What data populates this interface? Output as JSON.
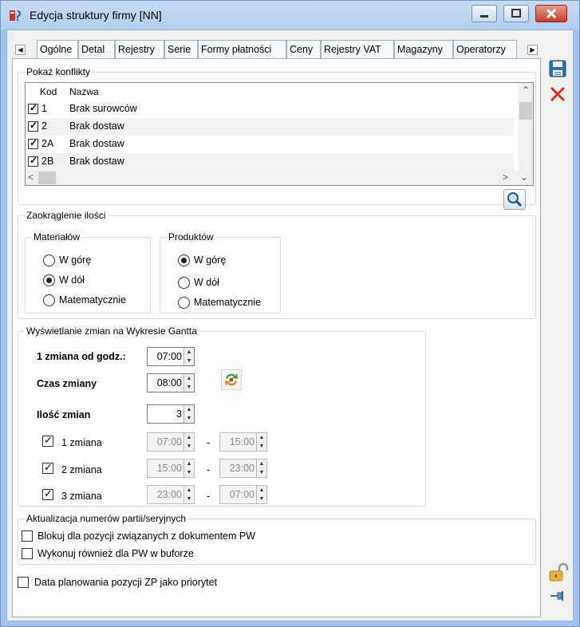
{
  "window": {
    "title": "Edycja struktury firmy [NN]"
  },
  "tabs": [
    "Ogólne",
    "Detal",
    "Rejestry",
    "Serie",
    "Formy płatności",
    "Ceny",
    "Rejestry VAT",
    "Magazyny",
    "Operatorzy"
  ],
  "conflicts": {
    "title": "Pokaż konflikty",
    "columns": {
      "code": "Kod",
      "name": "Nazwa"
    },
    "rows": [
      {
        "code": "1",
        "name": "Brak surowców",
        "checked": true
      },
      {
        "code": "2",
        "name": "Brak dostaw",
        "checked": true
      },
      {
        "code": "2A",
        "name": "Brak dostaw",
        "checked": true
      },
      {
        "code": "2B",
        "name": "Brak dostaw",
        "checked": true
      }
    ]
  },
  "rounding": {
    "title": "Zaokrąglenie ilości",
    "materials": {
      "title": "Materiałów",
      "options": [
        "W górę",
        "W dół",
        "Matematycznie"
      ],
      "selected": "W dół"
    },
    "products": {
      "title": "Produktów",
      "options": [
        "W górę",
        "W dół",
        "Matematycznie"
      ],
      "selected": "W górę"
    }
  },
  "gantt": {
    "title": "Wyświetlanie zmian na Wykresie Gantta",
    "first_shift_label": "1 zmiana od godz.:",
    "first_shift_value": "07:00",
    "shift_length_label": "Czas zmiany",
    "shift_length_value": "08:00",
    "shift_count_label": "Ilość zmian",
    "shift_count_value": "3",
    "dash": "-",
    "shifts": [
      {
        "label": "1 zmiana",
        "checked": true,
        "from": "07:00",
        "to": "15:00"
      },
      {
        "label": "2 zmiana",
        "checked": true,
        "from": "15:00",
        "to": "23:00"
      },
      {
        "label": "3 zmiana",
        "checked": true,
        "from": "23:00",
        "to": "07:00"
      }
    ]
  },
  "batch": {
    "title": "Aktualizacja numerów partii/seryjnych",
    "block_label": "Blokuj dla pozycji związanych z dokumentem PW",
    "block_checked": false,
    "buffer_label": "Wykonuj również dla PW w buforze",
    "buffer_checked": false
  },
  "priority": {
    "label": "Data planowania pozycji ZP jako priorytet",
    "checked": false
  },
  "colors": {
    "accent": "#99b4d1",
    "close": "#c6402b",
    "save": "#2f6fb3",
    "delete": "#d93025"
  }
}
